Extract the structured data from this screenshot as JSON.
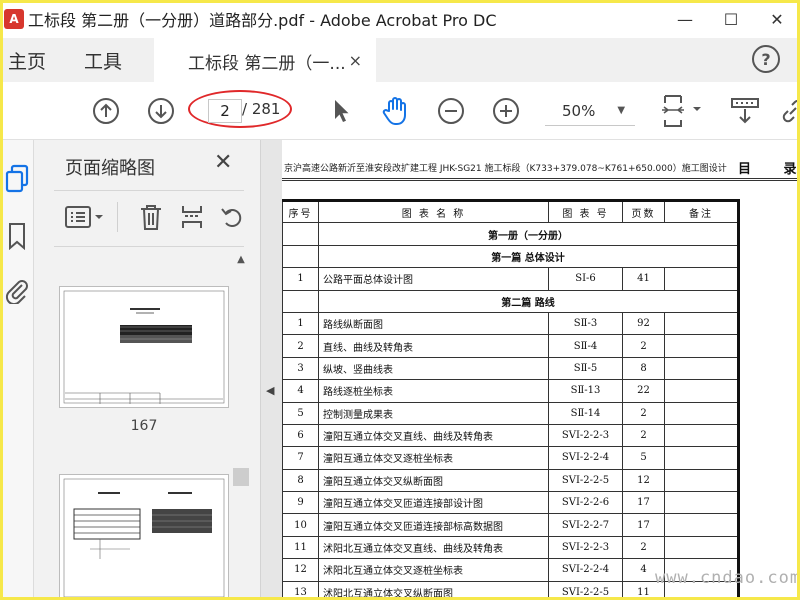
{
  "window": {
    "title": "工标段 第二册（一分册）道路部分.pdf - Adobe Acrobat Pro DC",
    "minimize_glyph": "—",
    "maximize_glyph": "☐",
    "close_glyph": "✕"
  },
  "tabs": {
    "home": "主页",
    "tools": "工具",
    "document": "工标段 第二册（一...",
    "close_glyph": "×",
    "help_glyph": "?"
  },
  "toolbar": {
    "page_current": "2",
    "page_total": "/ 281",
    "zoom": "50%",
    "zoom_arrow": "▼"
  },
  "thumbnails": {
    "title": "页面缩略图",
    "close_glyph": "✕",
    "pages": [
      {
        "label": "167"
      },
      {
        "label": ""
      }
    ]
  },
  "document": {
    "header": "京沪高速公路新沂至淮安段改扩建工程 JHK-SG21 施工标段（K733+379.078~K761+650.000）施工图设计",
    "contents_title": "目 录",
    "columns": [
      "序号",
      "图 表 名 称",
      "图 表 号",
      "页数",
      "备注"
    ],
    "volume": "第一册（一分册）",
    "part1": "第一篇 总体设计",
    "part2": "第二篇 路线",
    "part1_rows": [
      {
        "no": "1",
        "name": "公路平面总体设计图",
        "code": "SⅠ-6",
        "pages": "41",
        "note": ""
      }
    ],
    "part2_rows": [
      {
        "no": "1",
        "name": "路线纵断面图",
        "code": "SⅡ-3",
        "pages": "92",
        "note": ""
      },
      {
        "no": "2",
        "name": "直线、曲线及转角表",
        "code": "SⅡ-4",
        "pages": "2",
        "note": ""
      },
      {
        "no": "3",
        "name": "纵坡、竖曲线表",
        "code": "SⅡ-5",
        "pages": "8",
        "note": ""
      },
      {
        "no": "4",
        "name": "路线逐桩坐标表",
        "code": "SⅡ-13",
        "pages": "22",
        "note": ""
      },
      {
        "no": "5",
        "name": "控制测量成果表",
        "code": "SⅡ-14",
        "pages": "2",
        "note": ""
      },
      {
        "no": "6",
        "name": "潼阳互通立体交叉直线、曲线及转角表",
        "code": "SVI-2-2-3",
        "pages": "2",
        "note": ""
      },
      {
        "no": "7",
        "name": "潼阳互通立体交叉逐桩坐标表",
        "code": "SVI-2-2-4",
        "pages": "5",
        "note": ""
      },
      {
        "no": "8",
        "name": "潼阳互通立体交叉纵断面图",
        "code": "SVI-2-2-5",
        "pages": "12",
        "note": ""
      },
      {
        "no": "9",
        "name": "潼阳互通立体交叉匝道连接部设计图",
        "code": "SVI-2-2-6",
        "pages": "17",
        "note": ""
      },
      {
        "no": "10",
        "name": "潼阳互通立体交叉匝道连接部标高数据图",
        "code": "SVI-2-2-7",
        "pages": "17",
        "note": ""
      },
      {
        "no": "11",
        "name": "沭阳北互通立体交叉直线、曲线及转角表",
        "code": "SVI-2-2-3",
        "pages": "2",
        "note": ""
      },
      {
        "no": "12",
        "name": "沭阳北互通立体交叉逐桩坐标表",
        "code": "SVI-2-2-4",
        "pages": "4",
        "note": ""
      },
      {
        "no": "13",
        "name": "沭阳北互通立体交叉纵断面图",
        "code": "SVI-2-2-5",
        "pages": "11",
        "note": ""
      }
    ]
  },
  "watermark": "www.cndao.com",
  "colors": {
    "frame": "#f6e84a",
    "annotation_ellipse": "#e0282a",
    "hand_tool_active": "#1473e6",
    "app_icon": "#d7372e",
    "sidebar_active": "#1473e6"
  }
}
